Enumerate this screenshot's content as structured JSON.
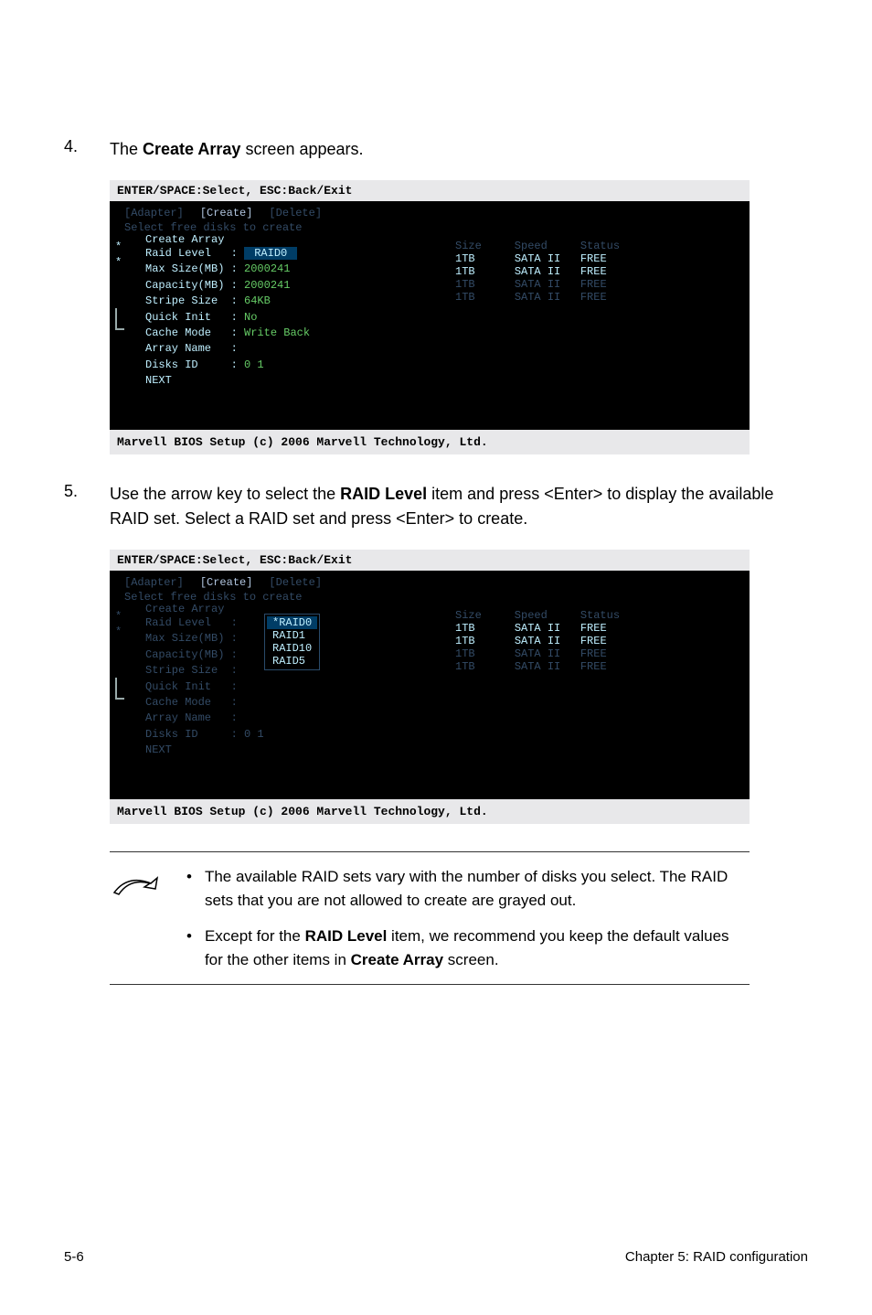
{
  "step4": {
    "num": "4.",
    "text_prefix": "The ",
    "text_bold": "Create Array",
    "text_suffix": " screen appears."
  },
  "step5": {
    "num": "5.",
    "text_p1": "Use the arrow key to select the ",
    "text_b1": "RAID Level",
    "text_p2": " item and press <Enter> to display the available RAID set. Select a RAID set and press <Enter> to create."
  },
  "bios_common": {
    "header": "ENTER/SPACE:Select, ESC:Back/Exit",
    "tabs": [
      "[Adapter]",
      "[Create]",
      "[Delete]"
    ],
    "select_line": "Select free disks to create",
    "array_title": "Create Array",
    "footer": "Marvell BIOS Setup (c) 2006 Marvell Technology, Ltd.",
    "disk_header": "Size     Speed     Status"
  },
  "bios1": {
    "fields": [
      {
        "label": "Raid Level  ",
        "value": " RAID0 ",
        "style": "highlight"
      },
      {
        "label": "Max Size(MB)",
        "value": "2000241",
        "style": "green"
      },
      {
        "label": "Capacity(MB)",
        "value": "2000241",
        "style": "green"
      },
      {
        "label": "Stripe Size ",
        "value": "64KB",
        "style": "green"
      },
      {
        "label": "Quick Init  ",
        "value": "No",
        "style": "green"
      },
      {
        "label": "Cache Mode  ",
        "value": "Write Back",
        "style": "green"
      },
      {
        "label": "Array Name  ",
        "value": "",
        "style": "green"
      },
      {
        "label": "Disks ID    ",
        "value": "0 1",
        "style": "green"
      },
      {
        "label": "NEXT",
        "value": "",
        "style": "none"
      }
    ],
    "disks": [
      {
        "size": "1TB",
        "speed": "SATA II",
        "status": "FREE",
        "bright": true
      },
      {
        "size": "1TB",
        "speed": "SATA II",
        "status": "FREE",
        "bright": true
      },
      {
        "size": "1TB",
        "speed": "SATA II",
        "status": "FREE",
        "bright": false
      },
      {
        "size": "1TB",
        "speed": "SATA II",
        "status": "FREE",
        "bright": false
      }
    ]
  },
  "bios2": {
    "fields": [
      {
        "label": "Raid Level  "
      },
      {
        "label": "Max Size(MB)"
      },
      {
        "label": "Capacity(MB)"
      },
      {
        "label": "Stripe Size "
      },
      {
        "label": "Quick Init  "
      },
      {
        "label": "Cache Mode  "
      },
      {
        "label": "Array Name  "
      },
      {
        "label": "Disks ID    ",
        "value": "0 1"
      },
      {
        "label": "NEXT"
      }
    ],
    "dropdown": [
      "*RAID0",
      "RAID1",
      "RAID10",
      "RAID5"
    ],
    "disks": [
      {
        "size": "1TB",
        "speed": "SATA II",
        "status": "FREE",
        "bright": true
      },
      {
        "size": "1TB",
        "speed": "SATA II",
        "status": "FREE",
        "bright": true
      },
      {
        "size": "1TB",
        "speed": "SATA II",
        "status": "FREE",
        "bright": false
      },
      {
        "size": "1TB",
        "speed": "SATA II",
        "status": "FREE",
        "bright": false
      }
    ]
  },
  "notes": {
    "n1": "The available RAID sets vary with the number of disks you select. The RAID sets that you are not allowed to create are grayed out.",
    "n2_p1": "Except for the ",
    "n2_b1": "RAID Level",
    "n2_p2": " item, we recommend you keep the default values for the other items in ",
    "n2_b2": "Create Array",
    "n2_p3": " screen."
  },
  "footer": {
    "left": "5-6",
    "right": "Chapter 5: RAID configuration"
  }
}
